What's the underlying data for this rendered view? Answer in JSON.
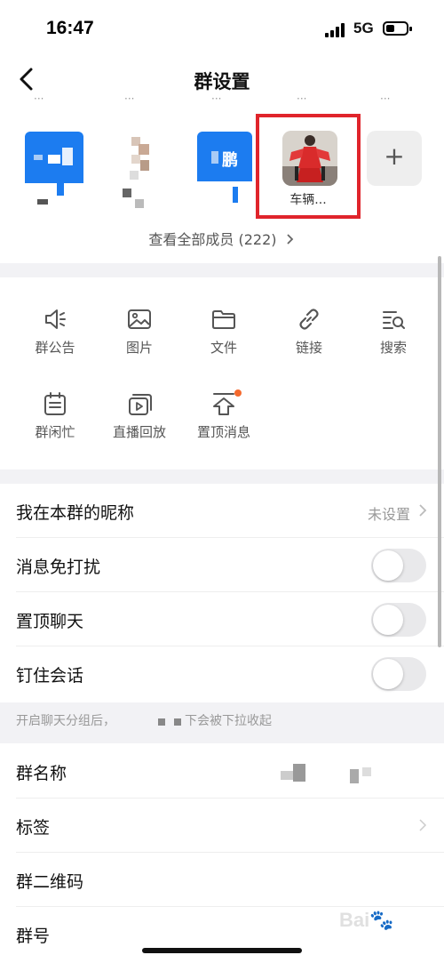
{
  "status_bar": {
    "time": "16:47",
    "network": "5G",
    "battery_level": 0.45
  },
  "navbar": {
    "back_icon": "chevron-left-icon",
    "title": "群设置"
  },
  "members": {
    "cut_names": [
      "···",
      "···",
      "···",
      "···",
      "···"
    ],
    "avatar_text": "鹏",
    "selected_name": "车辆...",
    "add_label": "+",
    "view_all": "查看全部成员 (222)",
    "highlight_color": "#e0242b"
  },
  "tools": [
    {
      "label": "群公告",
      "icon": "megaphone-icon"
    },
    {
      "label": "图片",
      "icon": "image-icon"
    },
    {
      "label": "文件",
      "icon": "folder-icon"
    },
    {
      "label": "链接",
      "icon": "link-icon"
    },
    {
      "label": "搜索",
      "icon": "search-list-icon"
    },
    {
      "label": "群闲忙",
      "icon": "calendar-icon"
    },
    {
      "label": "直播回放",
      "icon": "replay-icon"
    },
    {
      "label": "置顶消息",
      "icon": "pin-top-icon"
    }
  ],
  "settings": {
    "nickname": {
      "label": "我在本群的昵称",
      "value": "未设置"
    },
    "mute": {
      "label": "消息免打扰",
      "on": false
    },
    "pin_chat": {
      "label": "置顶聊天",
      "on": false
    },
    "stick_session": {
      "label": "钉住会话",
      "on": false
    },
    "hint": "开启聊天分组后，",
    "hint_tail": "下会被下拉收起"
  },
  "info": {
    "group_name": {
      "label": "群名称"
    },
    "tags": {
      "label": "标签"
    },
    "qr_code": {
      "label": "群二维码"
    },
    "group_number": {
      "label": "群号"
    }
  },
  "colors": {
    "accent_blue": "#1c7cf0",
    "badge_orange": "#f56a2e"
  }
}
